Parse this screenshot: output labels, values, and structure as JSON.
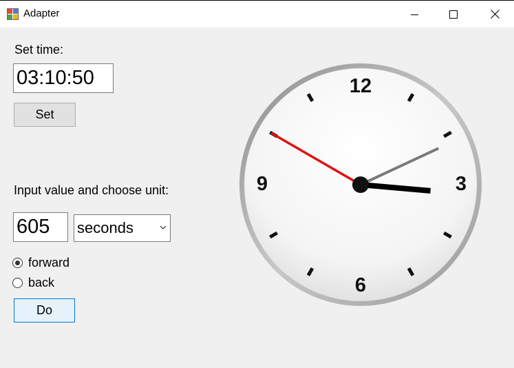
{
  "window": {
    "title": "Adapter",
    "controls": {
      "minimize_icon": "minimize-icon",
      "maximize_icon": "maximize-icon",
      "close_icon": "close-icon"
    }
  },
  "set_time": {
    "label": "Set time:",
    "value": "03:10:50",
    "button_label": "Set"
  },
  "adjust": {
    "label": "Input value and choose unit:",
    "value": "605",
    "unit_selected": "seconds",
    "direction_options": [
      {
        "label": "forward",
        "checked": true
      },
      {
        "label": "back",
        "checked": false
      }
    ],
    "button_label": "Do"
  },
  "clock": {
    "numbers": [
      "12",
      "3",
      "6",
      "9"
    ],
    "time": {
      "hours": 3,
      "minutes": 10,
      "seconds": 50
    },
    "colors": {
      "hour_hand": "#000000",
      "minute_hand": "#7a7a7a",
      "second_hand": "#e11010",
      "rim": "#9a9a9a"
    }
  }
}
